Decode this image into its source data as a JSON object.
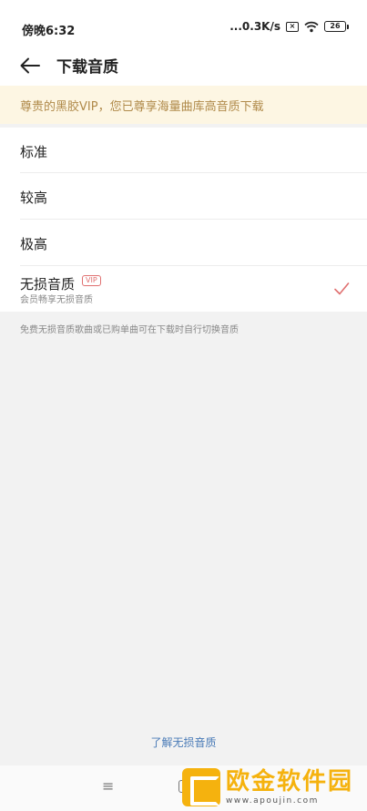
{
  "status_bar": {
    "time": "傍晚6:32",
    "network_speed": "...0.3K/s",
    "battery_level": "26",
    "x_icon": "×"
  },
  "header": {
    "title": "下载音质",
    "back_icon": "arrow-left-icon"
  },
  "vip_banner": {
    "text": "尊贵的黑胶VIP，您已尊享海量曲库高音质下载"
  },
  "options": [
    {
      "label": "标准",
      "selected": false
    },
    {
      "label": "较高",
      "selected": false
    },
    {
      "label": "极高",
      "selected": false
    },
    {
      "label": "无损音质",
      "tag": "VIP",
      "subtitle": "会员畅享无损音质",
      "selected": true
    }
  ],
  "hint": "免费无损音质歌曲或已购单曲可在下载时自行切换音质",
  "learn_more": "了解无损音质",
  "nav": {
    "menu_icon": "≡"
  },
  "watermark": {
    "title": "欧金软件园",
    "subtitle": "www.apoujin.com"
  },
  "colors": {
    "accent_red": "#e07070",
    "banner_bg": "#fdf6e3",
    "banner_text": "#b08a4a",
    "link": "#4a7bb7"
  }
}
